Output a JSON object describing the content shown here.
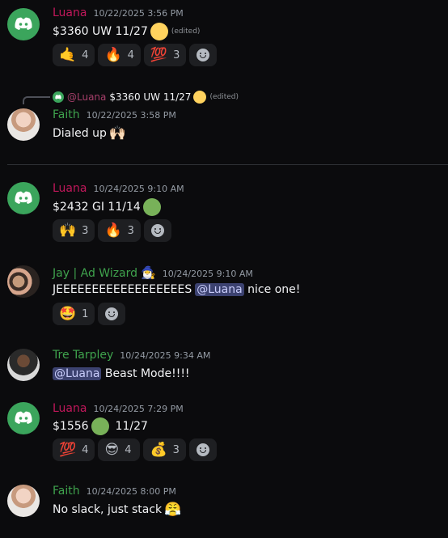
{
  "messages": [
    {
      "author": "Luana",
      "timestamp": "10/22/2025 3:56 PM",
      "text": "$3360 UW 11/27",
      "edited": "(edited)",
      "reactions": [
        {
          "emoji": "🤙",
          "count": "4"
        },
        {
          "emoji": "🔥",
          "count": "4"
        },
        {
          "emoji": "💯",
          "count": "3"
        }
      ]
    },
    {
      "reply_to": {
        "mention": "@Luana",
        "text": "$3360 UW 11/27",
        "edited": "(edited)"
      },
      "author": "Faith",
      "timestamp": "10/22/2025 3:58 PM",
      "text": "Dialed up",
      "emoji": "🙌🏻"
    },
    {
      "author": "Luana",
      "timestamp": "10/24/2025 9:10 AM",
      "text": "$2432 GI 11/14",
      "reactions": [
        {
          "emoji": "🙌",
          "count": "3"
        },
        {
          "emoji": "🔥",
          "count": "3"
        }
      ]
    },
    {
      "author": "Jay | Ad Wizard",
      "author_emoji": "🧙‍♂️",
      "timestamp": "10/24/2025 9:10 AM",
      "text": "JEEEEEEEEEEEEEEEEEES",
      "mention": "@Luana",
      "text_after": " nice one!",
      "reactions": [
        {
          "emoji": "🤩",
          "count": "1"
        }
      ]
    },
    {
      "author": "Tre Tarpley",
      "timestamp": "10/24/2025 9:34 AM",
      "mention": "@Luana",
      "text_after": " Beast Mode!!!!"
    },
    {
      "author": "Luana",
      "timestamp": "10/24/2025 7:29 PM",
      "text": "$1556",
      "text_after": "11/27",
      "reactions": [
        {
          "emoji": "💯",
          "count": "4"
        },
        {
          "emoji": "😎",
          "count": "4"
        },
        {
          "emoji": "💰",
          "count": "3"
        }
      ]
    },
    {
      "author": "Faith",
      "timestamp": "10/24/2025 8:00 PM",
      "text": "No slack, just stack",
      "emoji": "😤"
    }
  ],
  "icons": {
    "avatar_logo": "discord-logo-icon",
    "add_reaction": "add-reaction-smile-icon"
  },
  "colors": {
    "luana": "#c2185b",
    "member": "#3fa34d",
    "discord_green": "#3ba55c",
    "background": "#0b0b0d"
  }
}
